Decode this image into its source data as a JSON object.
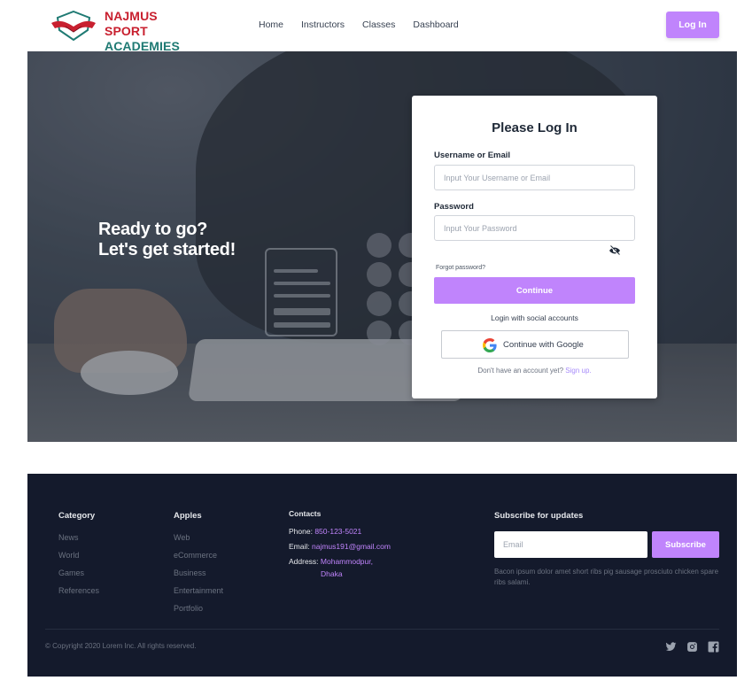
{
  "brand": {
    "line1": "NAJMUS SPORT",
    "line2": "ACADEMIES",
    "icon": "handshake-shield-logo"
  },
  "nav": {
    "links": [
      "Home",
      "Instructors",
      "Classes",
      "Dashboard"
    ],
    "login_label": "Log In"
  },
  "hero": {
    "tagline_1": "Ready to go?",
    "tagline_2": "Let's get started!"
  },
  "login": {
    "title": "Please Log In",
    "username_label": "Username or Email",
    "username_placeholder": "Input Your Username or Email",
    "password_label": "Password",
    "password_placeholder": "Input Your Password",
    "forgot_label": "Forgot password?",
    "continue_label": "Continue",
    "social_label": "Login with social accounts",
    "google_label": "Continue with Google",
    "no_account_text": "Don't have an account yet?",
    "signup_label": "Sign up."
  },
  "footer": {
    "category": {
      "title": "Category",
      "items": [
        "News",
        "World",
        "Games",
        "References"
      ]
    },
    "apples": {
      "title": "Apples",
      "items": [
        "Web",
        "eCommerce",
        "Business",
        "Entertainment",
        "Portfolio"
      ]
    },
    "contacts": {
      "title": "Contacts",
      "phone_label": "Phone:",
      "phone": "850-123-5021",
      "email_label": "Email:",
      "email": "najmus191@gmail.com",
      "address_label": "Address:",
      "address_1": "Mohammodpur,",
      "address_2": "Dhaka"
    },
    "subscribe": {
      "title": "Subscribe for updates",
      "placeholder": "Email",
      "button_label": "Subscribe",
      "description": "Bacon ipsum dolor amet short ribs pig sausage prosciuto chicken spare ribs salami."
    },
    "copyright": "© Copyright 2020 Lorem Inc. All rights reserved.",
    "social_icons": [
      "twitter-icon",
      "instagram-icon",
      "facebook-icon"
    ]
  },
  "colors": {
    "accent": "#c084fc",
    "footer_bg": "#141a2c",
    "brand_red": "#c8202f",
    "brand_teal": "#1f7a73"
  }
}
